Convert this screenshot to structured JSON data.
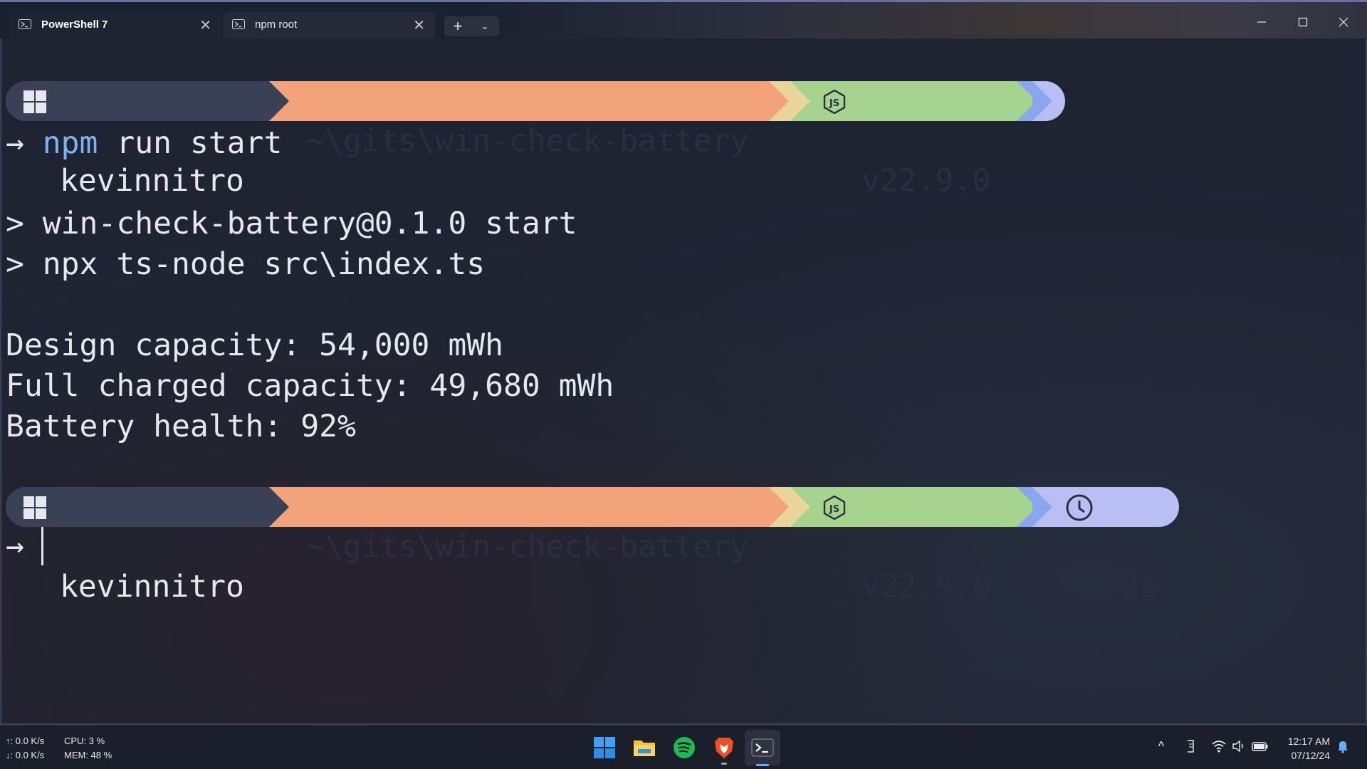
{
  "tabs": [
    {
      "title": "PowerShell 7",
      "active": true,
      "close": "✕"
    },
    {
      "title": "npm root",
      "active": false,
      "close": "✕"
    }
  ],
  "newtab": {
    "plus": "+",
    "dropdown": "⌄"
  },
  "prompt1": {
    "user": "kevinnitro",
    "path": "~\\gits\\win-check-battery",
    "node": "v22.9.0"
  },
  "cmd_arrow": "→",
  "command": {
    "npm": "npm",
    "rest": " run start"
  },
  "output": {
    "line1": "> win-check-battery@0.1.0 start",
    "line2": "> npx ts-node src\\index.ts",
    "line3": "Design capacity: 54,000 mWh",
    "line4": "Full charged capacity: 49,680 mWh",
    "line5": "Battery health: 92%"
  },
  "prompt2": {
    "user": "kevinnitro",
    "path": "~\\gits\\win-check-battery",
    "node": "v22.9.0",
    "time": "2s"
  },
  "taskbar": {
    "net_up": "↑: 0.0 K/s",
    "net_down": "↓: 0.0 K/s",
    "cpu": "CPU: 3 %",
    "mem": "MEM: 48 %",
    "time": "12:17 AM",
    "date": "07/12/24",
    "tray_chevron": "^"
  },
  "colors": {
    "user_segment": "#3a4157",
    "path_segment": "#f2a37a",
    "node_segment": "#a6d48f",
    "time_segment": "#b9bff2",
    "npm_keyword": "#7fb2f0"
  }
}
